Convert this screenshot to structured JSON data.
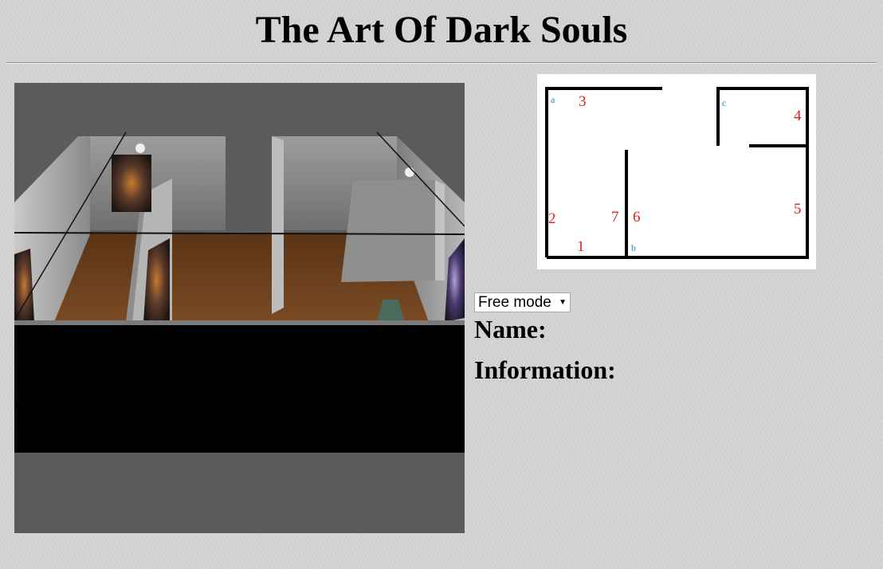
{
  "page": {
    "title": "The Art Of Dark Souls"
  },
  "viewport": {
    "icon": "3d-gallery-view"
  },
  "minimap": {
    "room_labels": [
      "a",
      "b",
      "c"
    ],
    "painting_numbers": [
      "1",
      "2",
      "3",
      "4",
      "5",
      "6",
      "7"
    ],
    "room_label_color": "#1b8fc4",
    "painting_number_color": "#e0201f"
  },
  "controls": {
    "mode_select": {
      "selected": "Free mode",
      "options": [
        "Free mode"
      ]
    }
  },
  "info": {
    "name_label": "Name:",
    "information_label": "Information:"
  },
  "colors": {
    "background": "#d3d3d3",
    "floor": "#6b3f1e",
    "wall": "#9a9a9a"
  }
}
